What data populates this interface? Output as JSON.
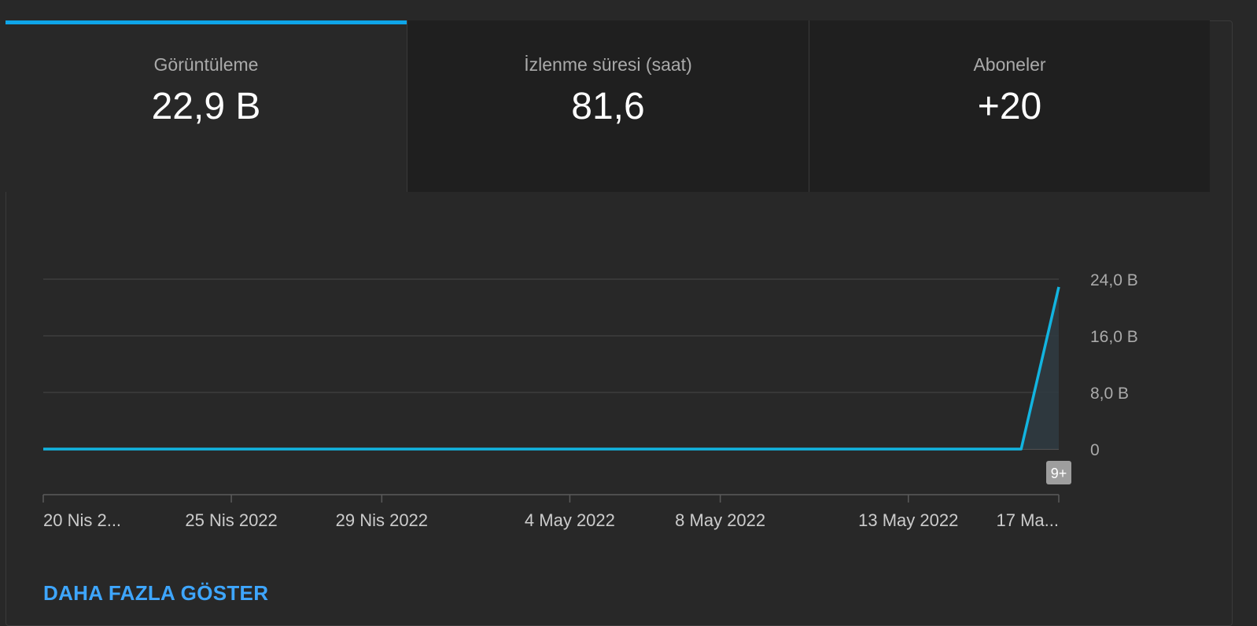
{
  "tabs": [
    {
      "label": "Görüntüleme",
      "value": "22,9 B",
      "active": true
    },
    {
      "label": "İzlenme süresi (saat)",
      "value": "81,6",
      "active": false
    },
    {
      "label": "Aboneler",
      "value": "+20",
      "active": false
    }
  ],
  "colors": {
    "accent": "#3ea6ff",
    "line": "#12b4e0",
    "indicator": "#0ea5e9",
    "background": "#282828",
    "inactive_tab": "#1f1f1f"
  },
  "chart_data": {
    "type": "area",
    "metric": "Görüntüleme",
    "x_tick_labels": [
      "20 Nis 2...",
      "25 Nis 2022",
      "29 Nis 2022",
      "4 May 2022",
      "8 May 2022",
      "13 May 2022",
      "17 Ma..."
    ],
    "x_ticks_day_index": [
      0,
      5,
      9,
      14,
      18,
      23,
      27
    ],
    "x_range_day_index": [
      0,
      27
    ],
    "y_tick_labels": [
      "0",
      "8,0 B",
      "16,0 B",
      "24,0 B"
    ],
    "y_ticks": [
      0,
      8000,
      16000,
      24000
    ],
    "ylim": [
      0,
      24000
    ],
    "grid": true,
    "series": [
      {
        "x_day_index": [
          0,
          26,
          27
        ],
        "values": [
          0,
          0,
          22900
        ]
      }
    ],
    "annotation": {
      "text": "9+",
      "x_day_index": 27
    }
  },
  "show_more_label": "DAHA FAZLA GÖSTER"
}
